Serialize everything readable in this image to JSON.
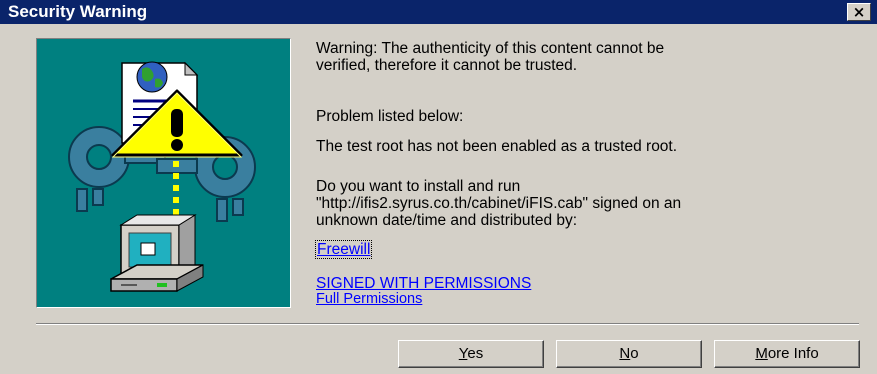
{
  "window": {
    "title": "Security Warning",
    "close_glyph": "×",
    "title_bar_color": "#0a246a",
    "panel_color": "#008080"
  },
  "message": {
    "warning": "Warning: The authenticity of this content cannot be\nverified, therefore it cannot be trusted.",
    "problem_heading": "Problem listed below:",
    "problem": "The test root has not been enabled as a trusted root.",
    "question": "Do you want to install and run\n\"http://ifis2.syrus.co.th/cabinet/iFIS.cab\" signed on an\nunknown date/time and distributed by:"
  },
  "publisher_link": "Freewill",
  "permissions": {
    "signed_link": "SIGNED WITH PERMISSIONS",
    "level_link": "Full Permissions"
  },
  "buttons": {
    "yes_mnemonic": "Y",
    "yes_rest": "es",
    "no_mnemonic": "N",
    "no_rest": "o",
    "more_mnemonic": "M",
    "more_rest": "ore Info"
  },
  "icons": [
    "certificate-document-icon",
    "globe-icon",
    "warning-triangle-icon",
    "keys-icon",
    "computer-icon"
  ]
}
